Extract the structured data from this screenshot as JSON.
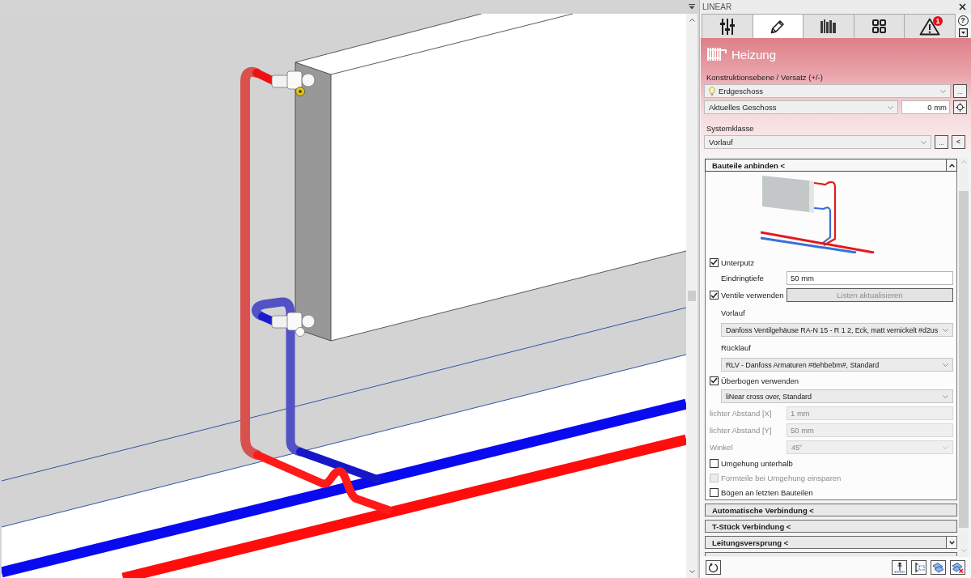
{
  "panel": {
    "title": "LINEAR",
    "help_button": "?"
  },
  "tabs": [
    {
      "kind": "sliders",
      "selected": false
    },
    {
      "kind": "edit",
      "selected": true
    },
    {
      "kind": "library",
      "selected": false
    },
    {
      "kind": "grid",
      "selected": false
    },
    {
      "kind": "warnings",
      "selected": false,
      "badge": "1"
    }
  ],
  "header": {
    "title": "Heizung"
  },
  "construction": {
    "label": "Konstruktionsebene / Versatz (+/-)",
    "plane": {
      "value": "Erdgeschoss"
    },
    "browse_button": "...",
    "reference": {
      "value": "Aktuelles Geschoss"
    },
    "offset": {
      "value": "0 mm"
    }
  },
  "system_class": {
    "label": "Systemklasse",
    "select": {
      "value": "Vorlauf"
    },
    "browse_button": "...",
    "collapse_button": "<"
  },
  "sections": [
    {
      "title": "Bauteile anbinden <",
      "expanded": true,
      "toggle_visible": true,
      "rows": [
        {
          "kind": "preview"
        },
        {
          "kind": "checkbox",
          "label": "Unterputz",
          "checked": true,
          "disabled": false,
          "children": [
            {
              "kind": "input",
              "label": "Eindringtiefe",
              "value": "50 mm",
              "disabled": false
            }
          ]
        },
        {
          "kind": "checkbox",
          "label": "Ventile verwenden",
          "checked": true,
          "disabled": false,
          "button": {
            "label": "Listen aktualisieren",
            "disabled": true
          },
          "children": [
            {
              "kind": "caption",
              "label": "Vorlauf"
            },
            {
              "kind": "select",
              "value": "Danfoss Ventilgehäuse RA-N 15 - R 1 2, Eck, matt vernickelt #d2us",
              "disabled": false
            },
            {
              "kind": "caption",
              "label": "Rücklauf"
            },
            {
              "kind": "select",
              "value": "RLV - Danfoss Armaturen #8ehbebm#, Standard",
              "disabled": false
            }
          ]
        },
        {
          "kind": "checkbox",
          "label": "Überbogen verwenden",
          "checked": true,
          "disabled": false,
          "children": [
            {
              "kind": "select",
              "value": "liNear cross over, Standard",
              "disabled": false
            }
          ]
        },
        {
          "kind": "input",
          "label": "lichter Abstand [X]",
          "value": "1 mm",
          "disabled": true
        },
        {
          "kind": "input",
          "label": "lichter Abstand [Y]",
          "value": "50 mm",
          "disabled": true
        },
        {
          "kind": "select",
          "label": "Winkel",
          "value": "45°",
          "disabled": true
        },
        {
          "kind": "checkbox",
          "label": "Umgehung unterhalb",
          "checked": false,
          "disabled": false
        },
        {
          "kind": "checkbox",
          "label": "Formteile bei Umgehung einsparen",
          "checked": false,
          "disabled": true
        },
        {
          "kind": "checkbox",
          "label": "Bögen an letzten Bauteilen",
          "checked": false,
          "disabled": false
        }
      ]
    },
    {
      "title": "Automatische Verbindung <",
      "expanded": false,
      "toggle_visible": false
    },
    {
      "title": "T-Stück Verbindung <",
      "expanded": false,
      "toggle_visible": false
    },
    {
      "title": "Leitungsversprung <",
      "expanded": false,
      "toggle_visible": true
    },
    {
      "expanded": false,
      "toggle_visible": false
    }
  ]
}
